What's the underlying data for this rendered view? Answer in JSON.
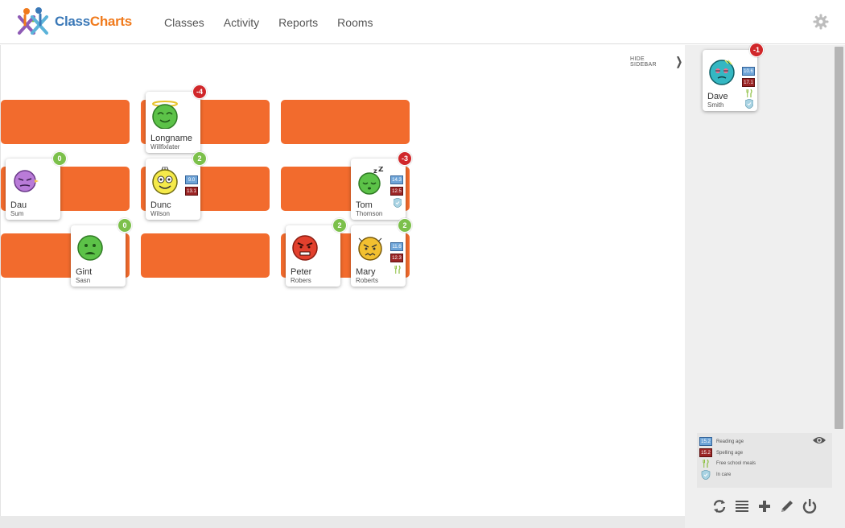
{
  "app": {
    "brand_class": "Class",
    "brand_charts": "Charts"
  },
  "nav": {
    "items": [
      "Classes",
      "Activity",
      "Reports",
      "Rooms"
    ]
  },
  "main": {
    "hide_sidebar_label": "HIDE SIDEBAR"
  },
  "students": [
    {
      "first": "Longname",
      "last": "Willfixlater",
      "score": "-4",
      "mood": "angel"
    },
    {
      "first": "Dau",
      "last": "Sum",
      "score": "0",
      "mood": "purple"
    },
    {
      "first": "Dunc",
      "last": "Wilson",
      "score": "2",
      "mood": "happy",
      "reading_age": "9.0",
      "spelling_age": "13.1"
    },
    {
      "first": "Tom",
      "last": "Thomson",
      "score": "-3",
      "mood": "sleepy",
      "reading_age": "14.3",
      "spelling_age": "12.5",
      "in_care": true
    },
    {
      "first": "Gint",
      "last": "Sasn",
      "score": "0",
      "mood": "sad"
    },
    {
      "first": "Peter",
      "last": "Robers",
      "score": "2",
      "mood": "angry"
    },
    {
      "first": "Mary",
      "last": "Roberts",
      "score": "2",
      "mood": "worried",
      "reading_age": "11.6",
      "spelling_age": "12.3",
      "free_school_meals": true
    }
  ],
  "sidebar": {
    "unseated": [
      {
        "first": "Dave",
        "last": "Smith",
        "score": "-1",
        "mood": "teal",
        "reading_age": "10.6",
        "spelling_age": "17.1",
        "free_school_meals": true,
        "in_care": true
      }
    ],
    "legend": {
      "reading_sample": "15.2",
      "spelling_sample": "15.2",
      "reading_label": "Reading age",
      "spelling_label": "Spelling age",
      "fsm_label": "Free school meals",
      "care_label": "In care"
    }
  },
  "colors": {
    "desk": "#f26b2d",
    "positive": "#7cc04b",
    "negative": "#d0272a",
    "reading_age": "#6fa5d8",
    "spelling_age": "#9b2525"
  }
}
